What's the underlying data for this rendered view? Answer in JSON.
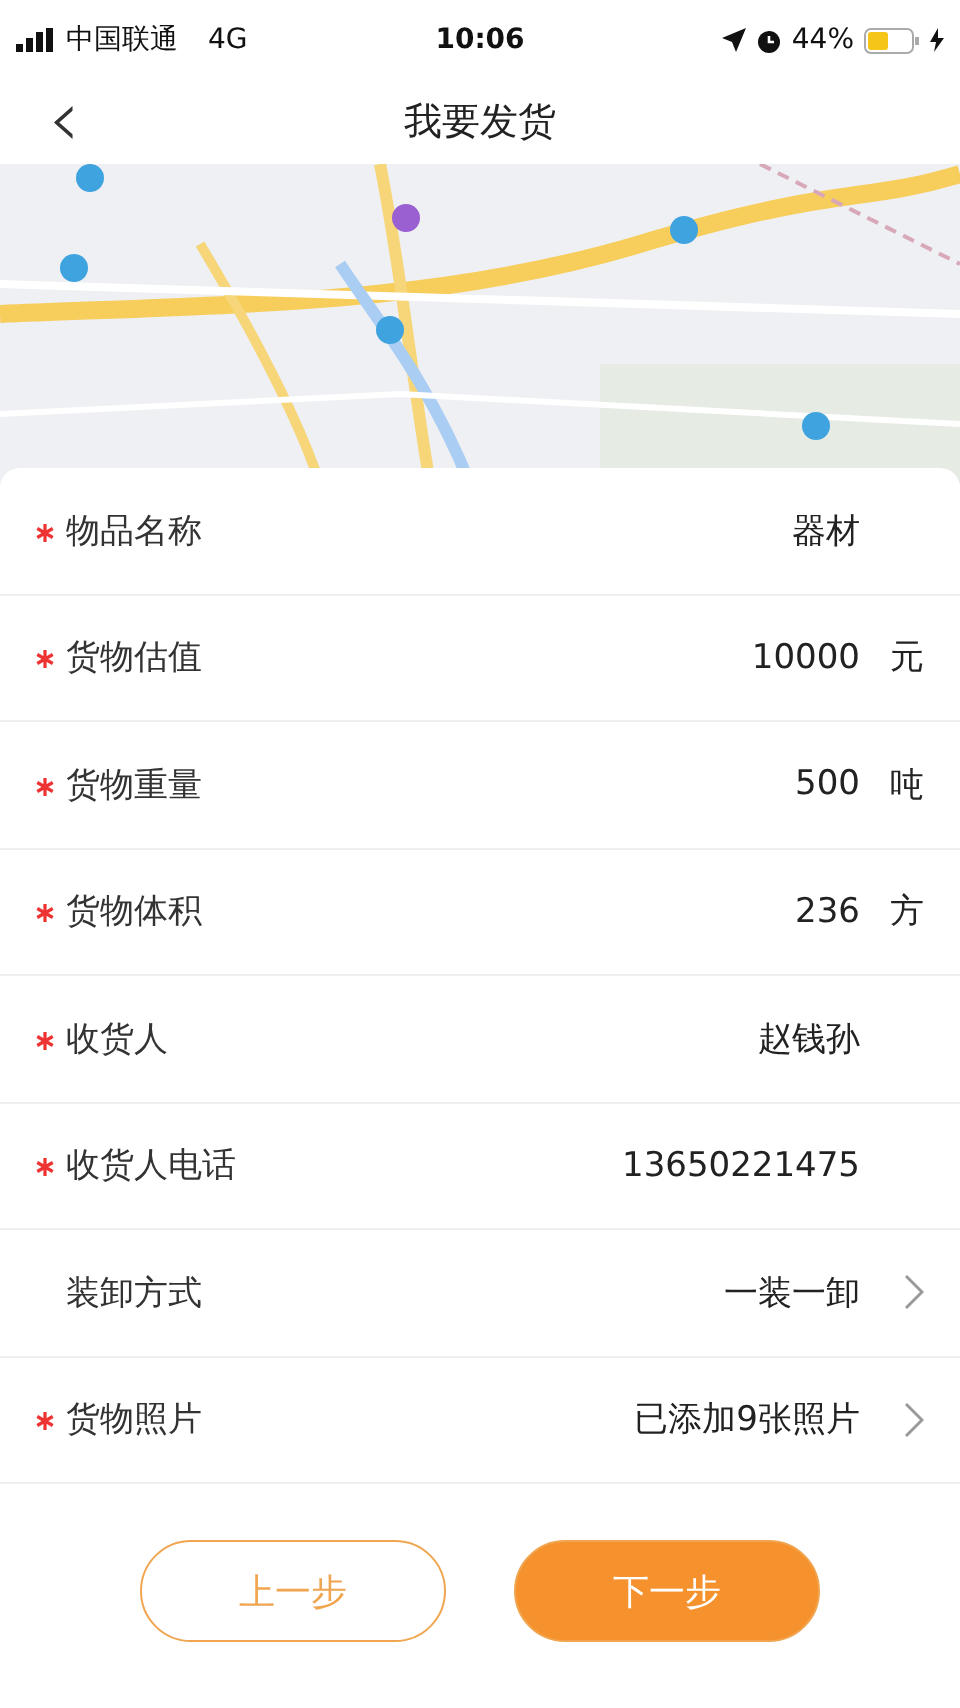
{
  "status_bar": {
    "carrier": "中国联通",
    "network": "4G",
    "time": "10:06",
    "battery": "44%"
  },
  "nav": {
    "back": "‹",
    "title": "我要发货"
  },
  "form": {
    "rows": [
      {
        "label": "物品名称",
        "required": true,
        "value": "器材",
        "kind": "text"
      },
      {
        "label": "货物估值",
        "required": true,
        "value": "10000",
        "unit": "元",
        "kind": "unit"
      },
      {
        "label": "货物重量",
        "required": true,
        "value": "500",
        "unit": "吨",
        "kind": "unit"
      },
      {
        "label": "货物体积",
        "required": true,
        "value": "236",
        "unit": "方",
        "kind": "unit"
      },
      {
        "label": "收货人",
        "required": true,
        "value": "赵钱孙",
        "kind": "text"
      },
      {
        "label": "收货人电话",
        "required": true,
        "value": "13650221475",
        "kind": "text"
      },
      {
        "label": "装卸方式",
        "required": false,
        "value": "一装一卸",
        "kind": "select"
      },
      {
        "label": "货物照片",
        "required": true,
        "value": "已添加9张照片",
        "kind": "select"
      }
    ]
  },
  "buttons": [
    {
      "label": "上一步",
      "kind": "secondary"
    },
    {
      "label": "下一步",
      "kind": "primary"
    }
  ]
}
